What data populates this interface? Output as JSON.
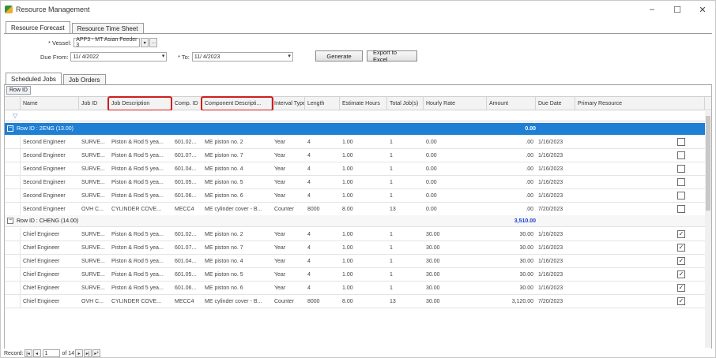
{
  "window": {
    "title": "Resource Management",
    "controls": {
      "minimize": "–",
      "maximize": "☐",
      "close": "✕"
    }
  },
  "outer_tabs": [
    {
      "label": "Resource Forecast",
      "active": true
    },
    {
      "label": "Resource Time Sheet",
      "active": false
    }
  ],
  "filters": {
    "vessel_label": "* Vessel:",
    "vessel_value": "APP3 - MT Asian Feeder 3",
    "due_from_label": "Due From:",
    "due_from_value": "11/ 4/2022",
    "to_label": "* To:",
    "to_value": "11/ 4/2023",
    "generate_label": "Generate",
    "export_label": "Export to Excel"
  },
  "inner_tabs": [
    {
      "label": "Scheduled Jobs",
      "active": true
    },
    {
      "label": "Job Orders",
      "active": false
    }
  ],
  "group_panel": {
    "chip_label": "Row ID"
  },
  "columns": [
    "Name",
    "Job ID",
    "Job Description",
    "Comp. ID",
    "Component Descripti...",
    "Interval Type",
    "Length",
    "Estimate Hours",
    "Total Job(s)",
    "Hourly Rate",
    "Amount",
    "Due Date",
    "Primary Resource"
  ],
  "highlight_color": "#d21c1c",
  "selection_color": "#1e7fd4",
  "groups": [
    {
      "label": "Row ID : 2ENG (13.00)",
      "total": "0.00",
      "selected": true,
      "rows": [
        {
          "name": "Second Engineer",
          "job_id": "SURVE...",
          "job_desc": "Piston & Rod 5 yea...",
          "comp_id": "601.02...",
          "comp_desc": "ME piston no. 2",
          "interval": "Year",
          "length": "4",
          "est_hours": "1.00",
          "total_jobs": "1",
          "rate": "0.00",
          "amount": ".00",
          "due": "1/16/2023",
          "primary": false
        },
        {
          "name": "Second Engineer",
          "job_id": "SURVE...",
          "job_desc": "Piston & Rod 5 yea...",
          "comp_id": "601.07...",
          "comp_desc": "ME piston no. 7",
          "interval": "Year",
          "length": "4",
          "est_hours": "1.00",
          "total_jobs": "1",
          "rate": "0.00",
          "amount": ".00",
          "due": "1/16/2023",
          "primary": false
        },
        {
          "name": "Second Engineer",
          "job_id": "SURVE...",
          "job_desc": "Piston & Rod 5 yea...",
          "comp_id": "601.04...",
          "comp_desc": "ME piston no. 4",
          "interval": "Year",
          "length": "4",
          "est_hours": "1.00",
          "total_jobs": "1",
          "rate": "0.00",
          "amount": ".00",
          "due": "1/16/2023",
          "primary": false
        },
        {
          "name": "Second Engineer",
          "job_id": "SURVE...",
          "job_desc": "Piston & Rod 5 yea...",
          "comp_id": "601.05...",
          "comp_desc": "ME piston no. 5",
          "interval": "Year",
          "length": "4",
          "est_hours": "1.00",
          "total_jobs": "1",
          "rate": "0.00",
          "amount": ".00",
          "due": "1/16/2023",
          "primary": false
        },
        {
          "name": "Second Engineer",
          "job_id": "SURVE...",
          "job_desc": "Piston & Rod 5 yea...",
          "comp_id": "601.06...",
          "comp_desc": "ME piston no. 6",
          "interval": "Year",
          "length": "4",
          "est_hours": "1.00",
          "total_jobs": "1",
          "rate": "0.00",
          "amount": ".00",
          "due": "1/16/2023",
          "primary": false
        },
        {
          "name": "Second Engineer",
          "job_id": "OVH C...",
          "job_desc": "CYLINDER COVE...",
          "comp_id": "MECC4",
          "comp_desc": "ME cylinder cover - B...",
          "interval": "Counter",
          "length": "8000",
          "est_hours": "8.00",
          "total_jobs": "13",
          "rate": "0.00",
          "amount": ".00",
          "due": "7/20/2023",
          "primary": false
        }
      ]
    },
    {
      "label": "Row ID : CHENG (14.00)",
      "total": "3,510.00",
      "selected": false,
      "rows": [
        {
          "name": "Chief Engineer",
          "job_id": "SURVE...",
          "job_desc": "Piston & Rod 5 yea...",
          "comp_id": "601.02...",
          "comp_desc": "ME piston no. 2",
          "interval": "Year",
          "length": "4",
          "est_hours": "1.00",
          "total_jobs": "1",
          "rate": "30.00",
          "amount": "30.00",
          "due": "1/16/2023",
          "primary": true
        },
        {
          "name": "Chief Engineer",
          "job_id": "SURVE...",
          "job_desc": "Piston & Rod 5 yea...",
          "comp_id": "601.07...",
          "comp_desc": "ME piston no. 7",
          "interval": "Year",
          "length": "4",
          "est_hours": "1.00",
          "total_jobs": "1",
          "rate": "30.00",
          "amount": "30.00",
          "due": "1/16/2023",
          "primary": true
        },
        {
          "name": "Chief Engineer",
          "job_id": "SURVE...",
          "job_desc": "Piston & Rod 5 yea...",
          "comp_id": "601.04...",
          "comp_desc": "ME piston no. 4",
          "interval": "Year",
          "length": "4",
          "est_hours": "1.00",
          "total_jobs": "1",
          "rate": "30.00",
          "amount": "30.00",
          "due": "1/16/2023",
          "primary": true
        },
        {
          "name": "Chief Engineer",
          "job_id": "SURVE...",
          "job_desc": "Piston & Rod 5 yea...",
          "comp_id": "601.05...",
          "comp_desc": "ME piston no. 5",
          "interval": "Year",
          "length": "4",
          "est_hours": "1.00",
          "total_jobs": "1",
          "rate": "30.00",
          "amount": "30.00",
          "due": "1/16/2023",
          "primary": true
        },
        {
          "name": "Chief Engineer",
          "job_id": "SURVE...",
          "job_desc": "Piston & Rod 5 yea...",
          "comp_id": "601.06...",
          "comp_desc": "ME piston no. 6",
          "interval": "Year",
          "length": "4",
          "est_hours": "1.00",
          "total_jobs": "1",
          "rate": "30.00",
          "amount": "30.00",
          "due": "1/16/2023",
          "primary": true
        },
        {
          "name": "Chief Engineer",
          "job_id": "OVH C...",
          "job_desc": "CYLINDER COVE...",
          "comp_id": "MECC4",
          "comp_desc": "ME cylinder cover - B...",
          "interval": "Counter",
          "length": "8000",
          "est_hours": "8.00",
          "total_jobs": "13",
          "rate": "30.00",
          "amount": "3,120.00",
          "due": "7/20/2023",
          "primary": true
        }
      ]
    }
  ],
  "navigator": {
    "label": "Record:",
    "current": "1",
    "of_text": "of 14"
  }
}
